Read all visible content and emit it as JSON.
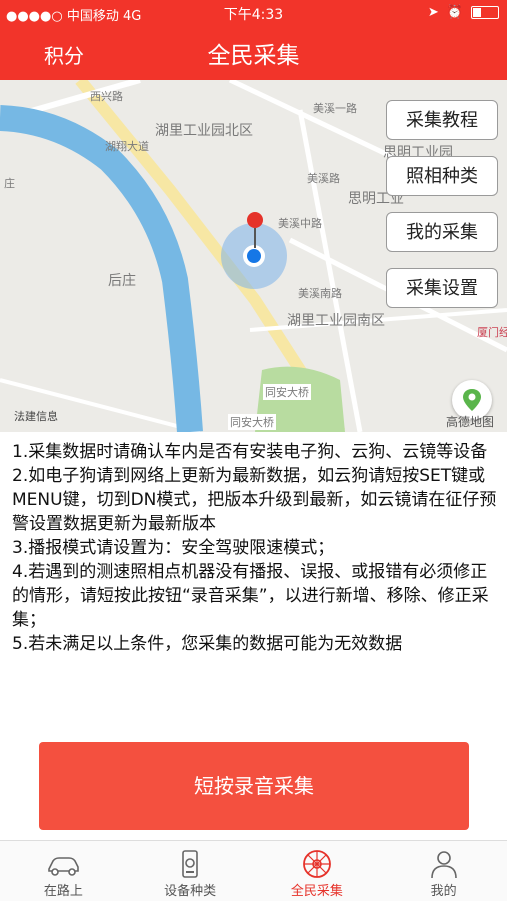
{
  "status_bar": {
    "carrier": "●●●●○ 中国移动  4G",
    "time": "下午4:33"
  },
  "nav": {
    "left_label": "积分",
    "title": "全民采集"
  },
  "map": {
    "labels": {
      "xiyi_road": "西兴路",
      "hubin_road": "湖翔大道",
      "huli_north": "湖里工业园北区",
      "siming": "思明工业园",
      "siming2": "思明工业",
      "meixi_road": "美溪中路",
      "meixi_south": "美溪南路",
      "houzhuang": "后庄",
      "huli_south": "湖里工业园南区",
      "tongan_bridge": "同安大桥",
      "tongan_bridge2": "同安大桥",
      "fajian": "法建信息",
      "xiamen": "厦门经",
      "meixi1": "美溪一路",
      "meixi2": "美溪路",
      "zhuang": "庄"
    },
    "buttons": [
      "采集教程",
      "照相种类",
      "我的采集",
      "采集设置"
    ],
    "attribution": "高德地图"
  },
  "instructions": [
    "1.采集数据时请确认车内是否有安装电子狗、云狗、云镜等设备",
    "2.如电子狗请到网络上更新为最新数据，如云狗请短按SET键或MENU键，切到DN模式，把版本升级到最新，如云镜请在征仔预警设置数据更新为最新版本",
    "3.播报模式请设置为：安全驾驶限速模式；",
    "4.若遇到的测速照相点机器没有播报、误报、或报错有必须修正的情形，请短按此按钮“录音采集”，以进行新增、移除、修正采集；",
    "5.若未满足以上条件，您采集的数据可能为无效数据"
  ],
  "record_button": "短按录音采集",
  "tabs": [
    {
      "label": "在路上",
      "icon": "car-icon"
    },
    {
      "label": "设备种类",
      "icon": "device-icon"
    },
    {
      "label": "全民采集",
      "icon": "collect-icon"
    },
    {
      "label": "我的",
      "icon": "person-icon"
    }
  ],
  "colors": {
    "brand_red": "#f2342a",
    "button_red": "#f4503f",
    "river": "#76b8e4",
    "location": "#1677e6"
  }
}
